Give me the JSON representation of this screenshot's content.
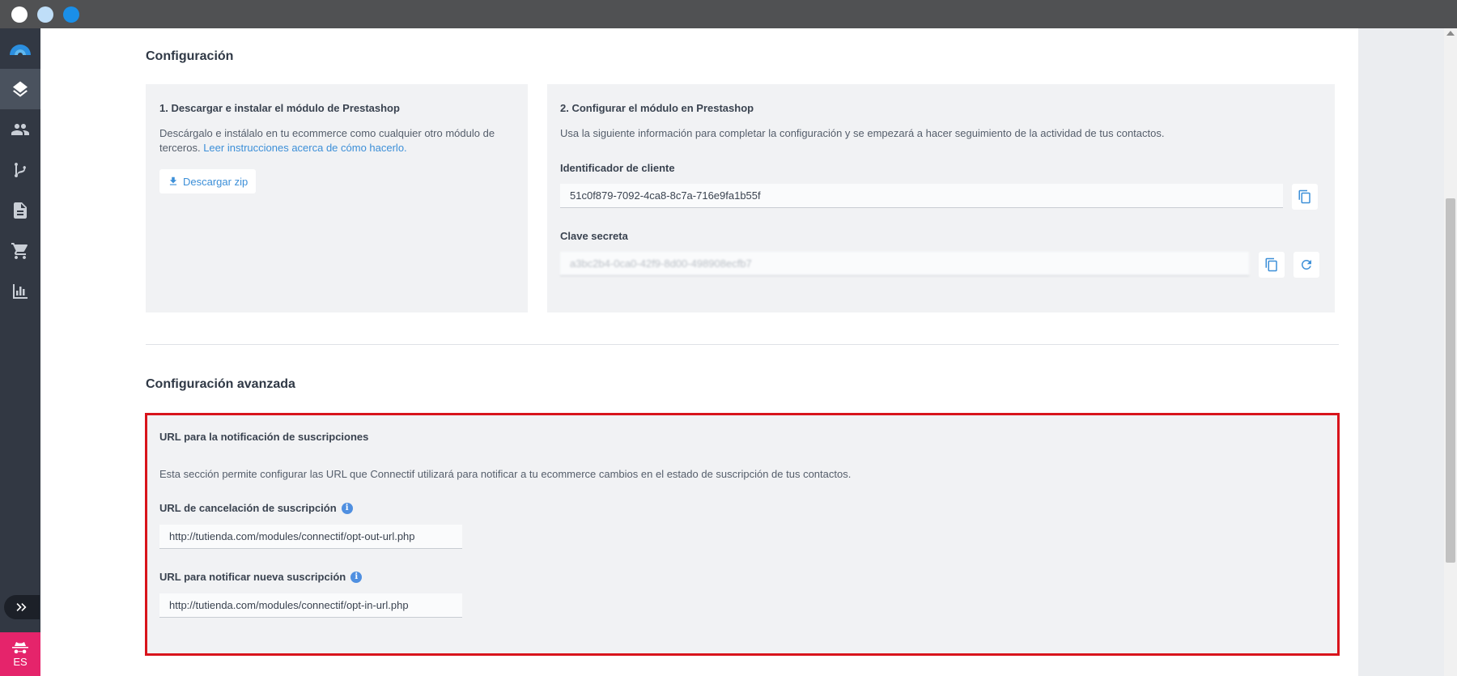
{
  "sidebar": {
    "items": [
      {
        "icon": "logo-icon"
      },
      {
        "icon": "layers-icon",
        "active": true
      },
      {
        "icon": "contacts-icon"
      },
      {
        "icon": "branch-icon"
      },
      {
        "icon": "document-icon"
      },
      {
        "icon": "cart-icon"
      },
      {
        "icon": "bar-chart-icon"
      }
    ],
    "language": "ES"
  },
  "config": {
    "title": "Configuración",
    "step1": {
      "title": "1. Descargar e instalar el módulo de Prestashop",
      "text": "Descárgalo e instálalo en tu ecommerce como cualquier otro módulo de terceros.",
      "link": "Leer instrucciones acerca de cómo hacerlo.",
      "download_label": "Descargar zip"
    },
    "step2": {
      "title": "2. Configurar el módulo en Prestashop",
      "text": "Usa la siguiente información para completar la configuración y se empezará a hacer seguimiento de la actividad de tus contactos.",
      "client_id_label": "Identificador de cliente",
      "client_id_value": "51c0f879-7092-4ca8-8c7a-716e9fa1b55f",
      "secret_label": "Clave secreta",
      "secret_value": "a3bc2b4-0ca0-42f9-8d00-498908ecfb7"
    }
  },
  "advanced": {
    "title": "Configuración avanzada",
    "section_title": "URL para la notificación de suscripciones",
    "description": "Esta sección permite configurar las URL que Connectif utilizará para notificar a tu ecommerce cambios en el estado de suscripción de tus contactos.",
    "optout_label": "URL de cancelación de suscripción",
    "optout_value": "http://tutienda.com/modules/connectif/opt-out-url.php",
    "optin_label": "URL para notificar nueva suscripción",
    "optin_value": "http://tutienda.com/modules/connectif/opt-in-url.php"
  }
}
